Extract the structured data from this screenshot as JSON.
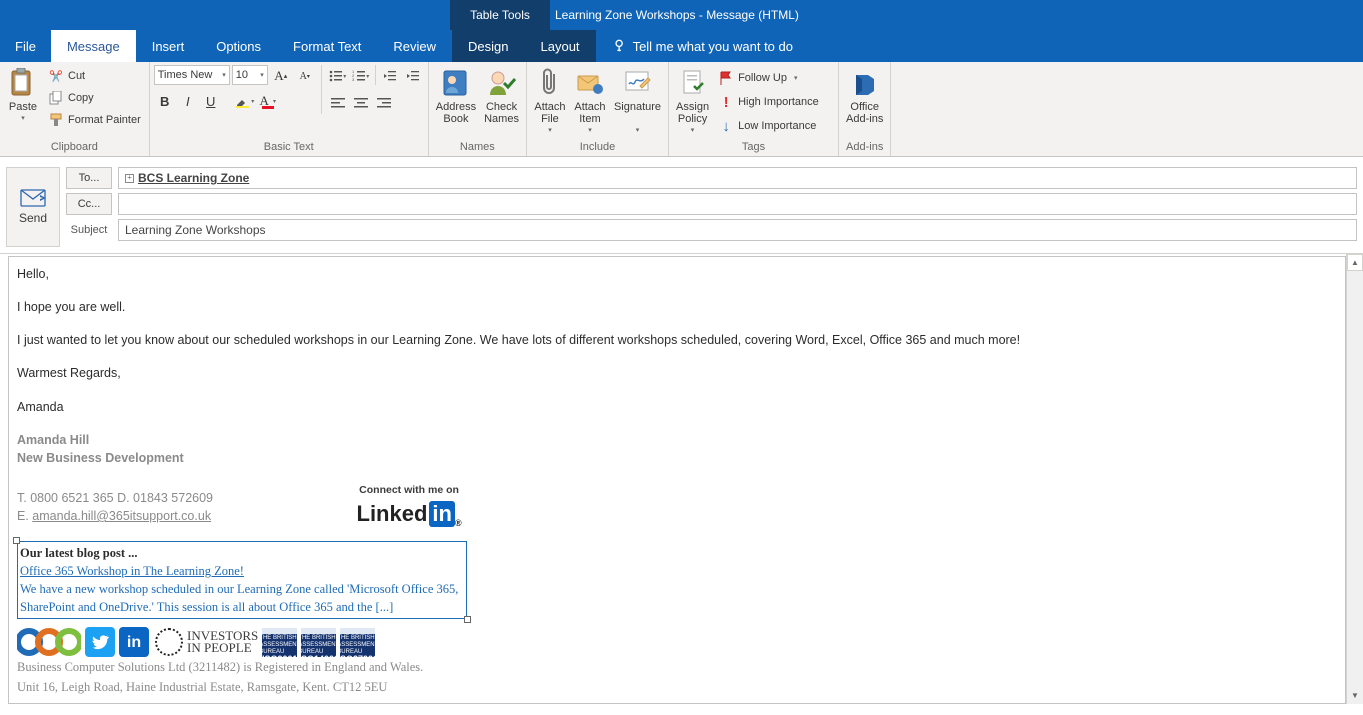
{
  "titlebar": {
    "table_tools": "Table Tools",
    "window_title": "Learning Zone Workshops - Message (HTML)"
  },
  "tabs": {
    "file": "File",
    "message": "Message",
    "insert": "Insert",
    "options": "Options",
    "format": "Format Text",
    "review": "Review",
    "design": "Design",
    "layout": "Layout",
    "tellme": "Tell me what you want to do"
  },
  "ribbon": {
    "clipboard": {
      "label": "Clipboard",
      "paste": "Paste",
      "cut": "Cut",
      "copy": "Copy",
      "fmt": "Format Painter"
    },
    "basictext": {
      "label": "Basic Text",
      "font": "Times New",
      "size": "10"
    },
    "names": {
      "label": "Names",
      "address": "Address\nBook",
      "check": "Check\nNames"
    },
    "include": {
      "label": "Include",
      "attachfile": "Attach\nFile",
      "attachitem": "Attach\nItem",
      "signature": "Signature"
    },
    "tags": {
      "label": "Tags",
      "assign": "Assign\nPolicy",
      "follow": "Follow Up",
      "high": "High Importance",
      "low": "Low Importance"
    },
    "addins": {
      "label": "Add-ins",
      "office": "Office\nAdd-ins"
    }
  },
  "address": {
    "send": "Send",
    "to": "To...",
    "cc": "Cc...",
    "subject_label": "Subject",
    "to_value": "BCS Learning Zone",
    "cc_value": "",
    "subject_value": "Learning Zone Workshops"
  },
  "body": {
    "greeting": "Hello,",
    "l1": "I hope you are well.",
    "l2": "I just wanted to let you know about our scheduled workshops in our Learning Zone. We have lots of different workshops scheduled, covering Word, Excel, Office 365 and much more!",
    "l3": "Warmest Regards,",
    "l4": "Amanda",
    "sig_name": "Amanda Hill",
    "sig_role": "New Business Development",
    "sig_phone": "T. 0800 6521 365   D. 01843 572609",
    "sig_email_label": "E. ",
    "sig_email": "amanda.hill@365itsupport.co.uk",
    "linkedin_top": "Connect with me on",
    "linkedin_brand1": "Linked",
    "linkedin_brand2": "in",
    "blog_title": "Our latest blog post ...",
    "blog_link": "Office 365 Workshop in The Learning Zone!",
    "blog_txt": "We have a new workshop scheduled in our Learning Zone called 'Microsoft Office 365, SharePoint and OneDrive.' This session is all about Office 365 and the [...]",
    "iip": "INVESTORS\nIN PEOPLE",
    "iso1": "ISO9001",
    "iso2": "ISO14001",
    "iso3": "ISO27001",
    "legal1": "Business Computer Solutions Ltd (3211482) is Registered in England and Wales.",
    "legal2": "Unit 16, Leigh Road, Haine Industrial Estate, Ramsgate, Kent. CT12 5EU"
  }
}
